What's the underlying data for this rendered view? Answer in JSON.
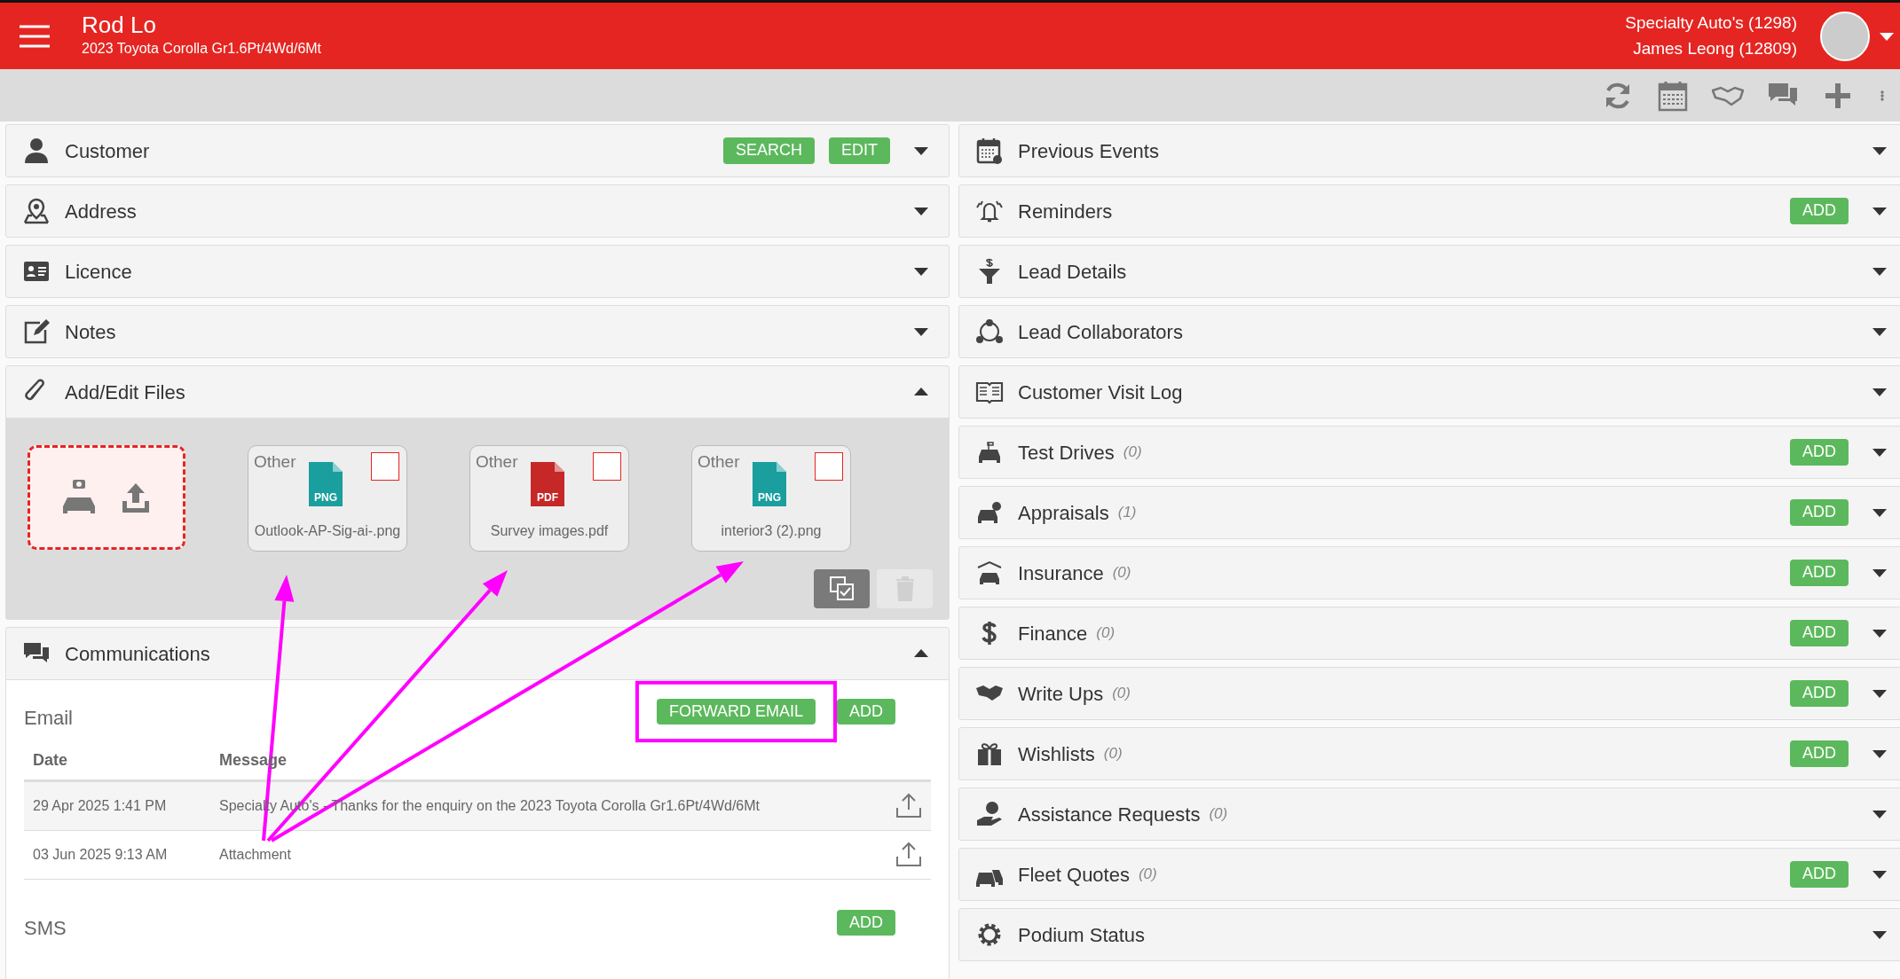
{
  "header": {
    "title": "Rod Lo",
    "subtitle": "2023 Toyota Corolla Gr1.6Pt/4Wd/6Mt",
    "account_lines": [
      "Specialty Auto's (1298)",
      "James Leong (12809)"
    ]
  },
  "left_panels": [
    {
      "title": "Customer",
      "buttons": [
        "SEARCH",
        "EDIT"
      ],
      "expanded": false
    },
    {
      "title": "Address",
      "expanded": false
    },
    {
      "title": "Licence",
      "expanded": false
    },
    {
      "title": "Notes",
      "expanded": false
    },
    {
      "title": "Add/Edit Files",
      "expanded": true,
      "kind": "files",
      "files": [
        {
          "category": "Other",
          "format": "PNG",
          "name": "Outlook-AP-Sig-ai-.png",
          "checked": false
        },
        {
          "category": "Other",
          "format": "PDF",
          "name": "Survey images.pdf",
          "checked": false
        },
        {
          "category": "Other",
          "format": "PNG",
          "name": "interior3 (2).png",
          "checked": false
        }
      ]
    },
    {
      "title": "Communications",
      "expanded": true,
      "kind": "communications",
      "sections": [
        {
          "title": "Email",
          "buttons": [
            "FORWARD EMAIL",
            "ADD"
          ],
          "columns": [
            "Date",
            "Message"
          ],
          "rows": [
            {
              "date": "29 Apr 2025 1:41 PM",
              "message": "Specialty Auto's - Thanks for the enquiry on the 2023 Toyota Corolla Gr1.6Pt/4Wd/6Mt"
            },
            {
              "date": "03 Jun 2025 9:13 AM",
              "message": "Attachment"
            }
          ]
        },
        {
          "title": "SMS",
          "buttons": [
            "ADD"
          ]
        }
      ]
    }
  ],
  "right_panels": [
    {
      "title": "Previous Events",
      "expanded": false
    },
    {
      "title": "Reminders",
      "buttons": [
        "ADD"
      ],
      "expanded": false
    },
    {
      "title": "Lead Details",
      "expanded": false
    },
    {
      "title": "Lead Collaborators",
      "expanded": false
    },
    {
      "title": "Customer Visit Log",
      "expanded": false
    },
    {
      "title": "Test Drives",
      "count": "(0)",
      "buttons": [
        "ADD"
      ],
      "expanded": false
    },
    {
      "title": "Appraisals",
      "count": "(1)",
      "buttons": [
        "ADD"
      ],
      "expanded": false
    },
    {
      "title": "Insurance",
      "count": "(0)",
      "buttons": [
        "ADD"
      ],
      "expanded": false
    },
    {
      "title": "Finance",
      "count": "(0)",
      "buttons": [
        "ADD"
      ],
      "expanded": false
    },
    {
      "title": "Write Ups",
      "count": "(0)",
      "buttons": [
        "ADD"
      ],
      "expanded": false
    },
    {
      "title": "Wishlists",
      "count": "(0)",
      "buttons": [
        "ADD"
      ],
      "expanded": false
    },
    {
      "title": "Assistance Requests",
      "count": "(0)",
      "expanded": false
    },
    {
      "title": "Fleet Quotes",
      "count": "(0)",
      "buttons": [
        "ADD"
      ],
      "expanded": false
    },
    {
      "title": "Podium Status",
      "expanded": false
    }
  ]
}
